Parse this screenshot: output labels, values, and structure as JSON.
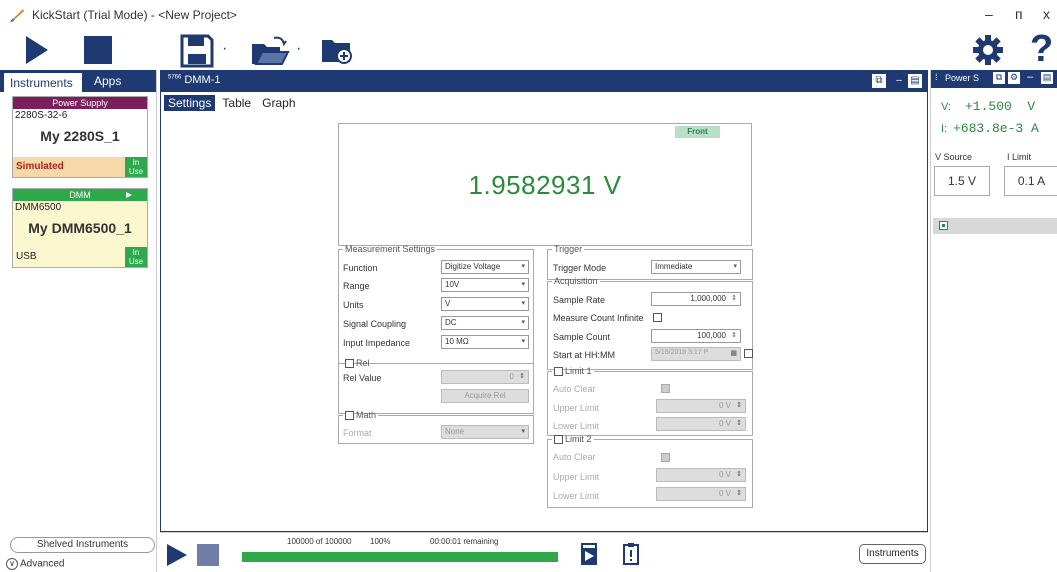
{
  "window": {
    "title": "KickStart (Trial Mode) - <New Project>",
    "btn_min": "–",
    "btn_restore": "ᴨ",
    "btn_close": "x"
  },
  "toolbar": {
    "icons": [
      "play-icon",
      "stop-icon",
      "save-icon",
      "open-folder-icon",
      "new-folder-icon",
      "gear-icon",
      "help-icon"
    ],
    "help_glyph": "?",
    "dot": "·"
  },
  "left": {
    "tabs": [
      "Instruments",
      "Apps"
    ],
    "cards": [
      {
        "type": "Power Supply",
        "model": "2280S-32-6",
        "name": "My 2280S_1",
        "status": "Simulated",
        "badge": "In Use"
      },
      {
        "type": "DMM",
        "model": "DMM6500",
        "name": "My DMM6500_1",
        "status": "USB",
        "badge": "In Use"
      }
    ],
    "shelved": "Shelved Instruments",
    "advanced": "Advanced"
  },
  "center": {
    "title": "DMM-1",
    "icon_label": "5766",
    "tabs": [
      "Settings",
      "Table",
      "Graph"
    ],
    "display": {
      "badge": "Front",
      "reading": "1.9582931 V"
    },
    "measurement": {
      "legend": "Measurement Settings",
      "function_label": "Function",
      "function_value": "Digitize Voltage",
      "range_label": "Range",
      "range_value": "10V",
      "units_label": "Units",
      "units_value": "V",
      "coupling_label": "Signal Coupling",
      "coupling_value": "DC",
      "impedance_label": "Input Impedance",
      "impedance_value": "10 MΩ"
    },
    "rel": {
      "legend": "Rel",
      "value_label": "Rel Value",
      "value": "0",
      "acquire": "Acquire Rel"
    },
    "math": {
      "legend": "Math",
      "format_label": "Format",
      "format_value": "None"
    },
    "trigger": {
      "legend": "Trigger",
      "mode_label": "Trigger Mode",
      "mode_value": "Immediate"
    },
    "acquisition": {
      "legend": "Acquisition",
      "rate_label": "Sample Rate",
      "rate_value": "1,000,000",
      "infinite_label": "Measure Count Infinite",
      "count_label": "Sample Count",
      "count_value": "100,000",
      "start_label": "Start at HH:MM",
      "start_value": "5/16/2018 3:17 P"
    },
    "limit1": {
      "legend": "Limit 1",
      "auto_clear": "Auto Clear",
      "upper_label": "Upper Limit",
      "upper_value": "0 V",
      "lower_label": "Lower Limit",
      "lower_value": "0 V"
    },
    "limit2": {
      "legend": "Limit 2",
      "auto_clear": "Auto Clear",
      "upper_label": "Upper Limit",
      "upper_value": "0 V",
      "lower_label": "Lower Limit",
      "lower_value": "0 V"
    },
    "progress": {
      "count": "100000 of 100000",
      "percent": "100%",
      "remaining": "00:00:01 remaining",
      "fraction": 1.0
    },
    "instruments_button": "Instruments"
  },
  "right": {
    "title": "Power S",
    "v_label": "V:",
    "v_value": "+1.500  V",
    "i_label": "I:",
    "i_value": "+683.8e-3 A",
    "vsource_label": "V Source",
    "ilimit_label": "I Limit",
    "vsource_value": "1.5 V",
    "ilimit_value": "0.1 A"
  },
  "colors": {
    "accent": "#1f3a73",
    "green": "#2ea84a",
    "reading": "#2a8a3e",
    "ps_header": "#7a1f5c"
  }
}
